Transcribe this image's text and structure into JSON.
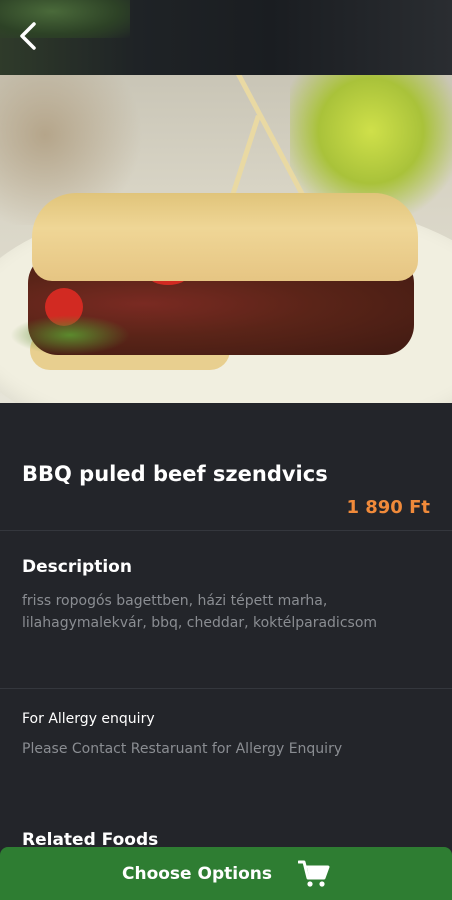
{
  "header": {
    "back_icon": "chevron-left-icon"
  },
  "product": {
    "title": "BBQ puled beef szendvics",
    "price": "1 890 Ft",
    "price_color": "#f08a3a"
  },
  "description": {
    "heading": "Description",
    "text": "friss ropogós bagettben, házi tépett marha, lilahagymalekvár, bbq, cheddar, koktélparadicsom"
  },
  "allergy": {
    "heading": "For Allergy enquiry",
    "text": "Please Contact Restaruant for Allergy Enquiry"
  },
  "related": {
    "heading": "Related Foods"
  },
  "action": {
    "label": "Choose Options",
    "icon": "cart-icon",
    "color": "#2e7d32"
  }
}
